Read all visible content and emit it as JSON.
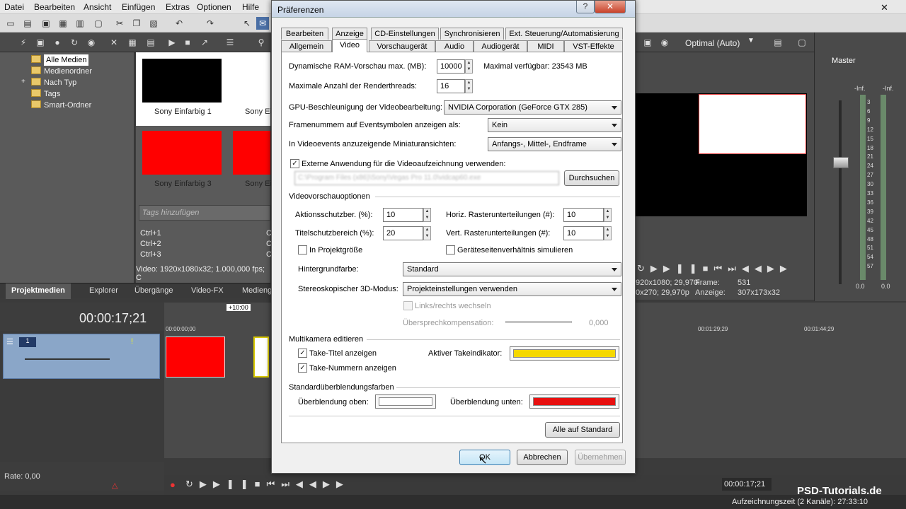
{
  "app": {
    "menu": [
      "Datei",
      "Bearbeiten",
      "Ansicht",
      "Einfügen",
      "Extras",
      "Optionen",
      "Hilfe"
    ],
    "preview_quality": "Optimal (Auto)",
    "explorer": {
      "tree": [
        "Alle Medien",
        "Medienordner",
        "Nach Typ",
        "Tags",
        "Smart-Ordner"
      ],
      "thumbs": [
        "Sony Einfarbig 1",
        "Sony Ein",
        "Sony Einfarbig 3",
        "Sony Ein"
      ],
      "tags_placeholder": "Tags hinzufügen",
      "shortcuts": [
        "Ctrl+1",
        "Ctrl+2",
        "Ctrl+3"
      ],
      "shortcut_cut": [
        "C",
        "C",
        "C"
      ],
      "info": "Video: 1920x1080x32; 1.000,000 fps; C",
      "tabs": [
        "Projektmedien",
        "Explorer",
        "Übergänge",
        "Video-FX",
        "Medieng"
      ]
    },
    "timeline": {
      "timecode": "00:00:17;21",
      "offset": "+10:00",
      "ruler": [
        "00:00:00;00",
        "00:01:29;29",
        "00:01:44;29"
      ],
      "rate": "Rate: 0,00",
      "cursor_time": "00:00:17;21"
    },
    "preview": {
      "info_line1": "920x1080; 29,970i",
      "info_line2": "0x270; 29,970p",
      "frame_label": "Frame:",
      "frame_value": "531",
      "display_label": "Anzeige:",
      "display_value": "307x173x32"
    },
    "master": {
      "title": "Master",
      "inf_left": "-Inf.",
      "inf_right": "-Inf.",
      "scale": [
        "3",
        "6",
        "9",
        "12",
        "15",
        "18",
        "21",
        "24",
        "27",
        "30",
        "33",
        "36",
        "39",
        "42",
        "45",
        "48",
        "51",
        "54",
        "57"
      ],
      "bottom_left": "0.0",
      "bottom_right": "0.0"
    },
    "status": {
      "record_time": "Aufzeichnungszeit (2 Kanäle): 27:33:10",
      "watermark": "PSD-Tutorials.de"
    }
  },
  "dialog": {
    "title": "Präferenzen",
    "tabs_row1": [
      "Bearbeiten",
      "Anzeige",
      "CD-Einstellungen",
      "Synchronisieren",
      "Ext. Steuerung/Automatisierung"
    ],
    "tabs_row2": [
      "Allgemein",
      "Video",
      "Vorschaugerät",
      "Audio",
      "Audiogerät",
      "MIDI",
      "VST-Effekte"
    ],
    "active_tab": "Video",
    "ram_label": "Dynamische RAM-Vorschau max. (MB):",
    "ram_value": "10000",
    "ram_available": "Maximal verfügbar: 23543 MB",
    "threads_label": "Maximale Anzahl der Renderthreads:",
    "threads_value": "16",
    "gpu_label": "GPU-Beschleunigung der Videobearbeitung:",
    "gpu_value": "NVIDIA Corporation (GeForce GTX 285)",
    "frames_label": "Framenummern auf Eventsymbolen anzeigen als:",
    "frames_value": "Kein",
    "thumbs_label": "In Videoevents anzuzeigende Miniaturansichten:",
    "thumbs_value": "Anfangs-, Mittel-, Endframe",
    "external_label": "Externe Anwendung für die Videoaufzeichnung verwenden:",
    "external_checked": true,
    "external_path": "C:\\Program Files (x86)\\Sony\\Vegas Pro 11.0\\vidcap60.exe",
    "browse_label": "Durchsuchen",
    "preview_section": "Videovorschauoptionen",
    "action_safe_label": "Aktionsschutzber. (%):",
    "action_safe_value": "10",
    "title_safe_label": "Titelschutzbereich (%):",
    "title_safe_value": "20",
    "hgrid_label": "Horiz. Rasterunterteilungen (#):",
    "hgrid_value": "10",
    "vgrid_label": "Vert. Rasterunterteilungen (#):",
    "vgrid_value": "10",
    "project_size_label": "In Projektgröße",
    "project_size_checked": false,
    "aspect_label": "Geräteseitenverhältnis simulieren",
    "aspect_checked": false,
    "bg_label": "Hintergrundfarbe:",
    "bg_value": "Standard",
    "stereo_label": "Stereoskopischer 3D-Modus:",
    "stereo_value": "Projekteinstellungen verwenden",
    "swap_label": "Links/rechts wechseln",
    "crosstalk_label": "Übersprechkompensation:",
    "crosstalk_value": "0,000",
    "multicam_section": "Multikamera editieren",
    "take_title_label": "Take-Titel anzeigen",
    "take_title_checked": true,
    "take_num_label": "Take-Nummern anzeigen",
    "take_num_checked": true,
    "active_take_label": "Aktiver Takeindikator:",
    "active_take_color": "#f5d800",
    "transition_section": "Standardüberblendungsfarben",
    "trans_top_label": "Überblendung oben:",
    "trans_top_color": "#ffffff",
    "trans_bottom_label": "Überblendung unten:",
    "trans_bottom_color": "#e81010",
    "reset_label": "Alle auf Standard",
    "ok_label": "OK",
    "cancel_label": "Abbrechen",
    "apply_label": "Übernehmen"
  }
}
